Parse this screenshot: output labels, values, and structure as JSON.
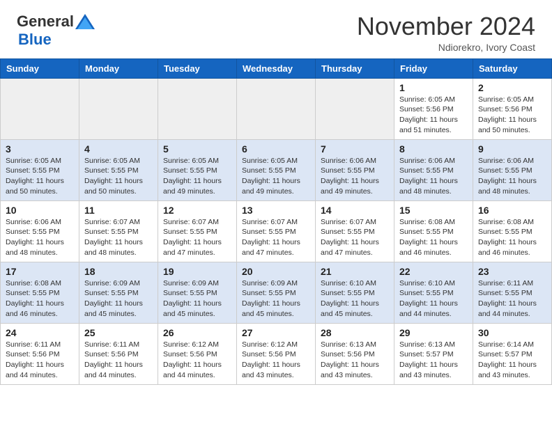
{
  "header": {
    "logo_general": "General",
    "logo_blue": "Blue",
    "month_title": "November 2024",
    "location": "Ndiorekro, Ivory Coast"
  },
  "days_of_week": [
    "Sunday",
    "Monday",
    "Tuesday",
    "Wednesday",
    "Thursday",
    "Friday",
    "Saturday"
  ],
  "weeks": [
    {
      "row_class": "week-row-1",
      "days": [
        {
          "number": "",
          "info": "",
          "empty": true
        },
        {
          "number": "",
          "info": "",
          "empty": true
        },
        {
          "number": "",
          "info": "",
          "empty": true
        },
        {
          "number": "",
          "info": "",
          "empty": true
        },
        {
          "number": "",
          "info": "",
          "empty": true
        },
        {
          "number": "1",
          "info": "Sunrise: 6:05 AM\nSunset: 5:56 PM\nDaylight: 11 hours\nand 51 minutes.",
          "empty": false
        },
        {
          "number": "2",
          "info": "Sunrise: 6:05 AM\nSunset: 5:56 PM\nDaylight: 11 hours\nand 50 minutes.",
          "empty": false
        }
      ]
    },
    {
      "row_class": "week-row-2",
      "days": [
        {
          "number": "3",
          "info": "Sunrise: 6:05 AM\nSunset: 5:55 PM\nDaylight: 11 hours\nand 50 minutes.",
          "empty": false
        },
        {
          "number": "4",
          "info": "Sunrise: 6:05 AM\nSunset: 5:55 PM\nDaylight: 11 hours\nand 50 minutes.",
          "empty": false
        },
        {
          "number": "5",
          "info": "Sunrise: 6:05 AM\nSunset: 5:55 PM\nDaylight: 11 hours\nand 49 minutes.",
          "empty": false
        },
        {
          "number": "6",
          "info": "Sunrise: 6:05 AM\nSunset: 5:55 PM\nDaylight: 11 hours\nand 49 minutes.",
          "empty": false
        },
        {
          "number": "7",
          "info": "Sunrise: 6:06 AM\nSunset: 5:55 PM\nDaylight: 11 hours\nand 49 minutes.",
          "empty": false
        },
        {
          "number": "8",
          "info": "Sunrise: 6:06 AM\nSunset: 5:55 PM\nDaylight: 11 hours\nand 48 minutes.",
          "empty": false
        },
        {
          "number": "9",
          "info": "Sunrise: 6:06 AM\nSunset: 5:55 PM\nDaylight: 11 hours\nand 48 minutes.",
          "empty": false
        }
      ]
    },
    {
      "row_class": "week-row-3",
      "days": [
        {
          "number": "10",
          "info": "Sunrise: 6:06 AM\nSunset: 5:55 PM\nDaylight: 11 hours\nand 48 minutes.",
          "empty": false
        },
        {
          "number": "11",
          "info": "Sunrise: 6:07 AM\nSunset: 5:55 PM\nDaylight: 11 hours\nand 48 minutes.",
          "empty": false
        },
        {
          "number": "12",
          "info": "Sunrise: 6:07 AM\nSunset: 5:55 PM\nDaylight: 11 hours\nand 47 minutes.",
          "empty": false
        },
        {
          "number": "13",
          "info": "Sunrise: 6:07 AM\nSunset: 5:55 PM\nDaylight: 11 hours\nand 47 minutes.",
          "empty": false
        },
        {
          "number": "14",
          "info": "Sunrise: 6:07 AM\nSunset: 5:55 PM\nDaylight: 11 hours\nand 47 minutes.",
          "empty": false
        },
        {
          "number": "15",
          "info": "Sunrise: 6:08 AM\nSunset: 5:55 PM\nDaylight: 11 hours\nand 46 minutes.",
          "empty": false
        },
        {
          "number": "16",
          "info": "Sunrise: 6:08 AM\nSunset: 5:55 PM\nDaylight: 11 hours\nand 46 minutes.",
          "empty": false
        }
      ]
    },
    {
      "row_class": "week-row-4",
      "days": [
        {
          "number": "17",
          "info": "Sunrise: 6:08 AM\nSunset: 5:55 PM\nDaylight: 11 hours\nand 46 minutes.",
          "empty": false
        },
        {
          "number": "18",
          "info": "Sunrise: 6:09 AM\nSunset: 5:55 PM\nDaylight: 11 hours\nand 45 minutes.",
          "empty": false
        },
        {
          "number": "19",
          "info": "Sunrise: 6:09 AM\nSunset: 5:55 PM\nDaylight: 11 hours\nand 45 minutes.",
          "empty": false
        },
        {
          "number": "20",
          "info": "Sunrise: 6:09 AM\nSunset: 5:55 PM\nDaylight: 11 hours\nand 45 minutes.",
          "empty": false
        },
        {
          "number": "21",
          "info": "Sunrise: 6:10 AM\nSunset: 5:55 PM\nDaylight: 11 hours\nand 45 minutes.",
          "empty": false
        },
        {
          "number": "22",
          "info": "Sunrise: 6:10 AM\nSunset: 5:55 PM\nDaylight: 11 hours\nand 44 minutes.",
          "empty": false
        },
        {
          "number": "23",
          "info": "Sunrise: 6:11 AM\nSunset: 5:55 PM\nDaylight: 11 hours\nand 44 minutes.",
          "empty": false
        }
      ]
    },
    {
      "row_class": "week-row-5",
      "days": [
        {
          "number": "24",
          "info": "Sunrise: 6:11 AM\nSunset: 5:56 PM\nDaylight: 11 hours\nand 44 minutes.",
          "empty": false
        },
        {
          "number": "25",
          "info": "Sunrise: 6:11 AM\nSunset: 5:56 PM\nDaylight: 11 hours\nand 44 minutes.",
          "empty": false
        },
        {
          "number": "26",
          "info": "Sunrise: 6:12 AM\nSunset: 5:56 PM\nDaylight: 11 hours\nand 44 minutes.",
          "empty": false
        },
        {
          "number": "27",
          "info": "Sunrise: 6:12 AM\nSunset: 5:56 PM\nDaylight: 11 hours\nand 43 minutes.",
          "empty": false
        },
        {
          "number": "28",
          "info": "Sunrise: 6:13 AM\nSunset: 5:56 PM\nDaylight: 11 hours\nand 43 minutes.",
          "empty": false
        },
        {
          "number": "29",
          "info": "Sunrise: 6:13 AM\nSunset: 5:57 PM\nDaylight: 11 hours\nand 43 minutes.",
          "empty": false
        },
        {
          "number": "30",
          "info": "Sunrise: 6:14 AM\nSunset: 5:57 PM\nDaylight: 11 hours\nand 43 minutes.",
          "empty": false
        }
      ]
    }
  ]
}
